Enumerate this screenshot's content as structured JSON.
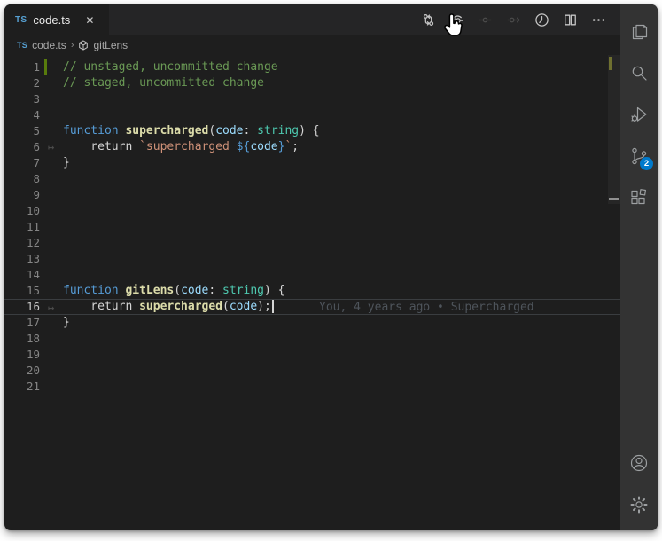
{
  "tab_bar": {
    "tab": {
      "label": "code.ts",
      "file_icon_label": "TS",
      "close_glyph": "✕"
    },
    "actions": [
      {
        "name": "gitlens-compare-button",
        "icon": "gitlens-compare",
        "enabled": true
      },
      {
        "name": "previous-change-button",
        "icon": "prev-change",
        "enabled": true
      },
      {
        "name": "current-change-button",
        "icon": "commit-dot",
        "enabled": false
      },
      {
        "name": "next-change-button",
        "icon": "next-change",
        "enabled": false
      },
      {
        "name": "file-history-button",
        "icon": "history-clock",
        "enabled": true
      },
      {
        "name": "split-editor-button",
        "icon": "split-editor",
        "enabled": true
      },
      {
        "name": "more-actions-button",
        "icon": "ellipsis",
        "enabled": true
      }
    ]
  },
  "breadcrumb": {
    "file_icon_label": "TS",
    "file": "code.ts",
    "separator": "›",
    "symbol": "gitLens"
  },
  "editor": {
    "gutter_arrow_glyph": "↦",
    "blame_text": "You, 4 years ago • Supercharged",
    "lines": [
      {
        "n": 1,
        "gutter": "added",
        "tokens": [
          {
            "t": "// unstaged, uncommitted change",
            "c": "comment"
          }
        ]
      },
      {
        "n": 2,
        "tokens": [
          {
            "t": "// staged, uncommitted change",
            "c": "comment"
          }
        ]
      },
      {
        "n": 3,
        "tokens": []
      },
      {
        "n": 4,
        "tokens": []
      },
      {
        "n": 5,
        "tokens": [
          {
            "t": "function ",
            "c": "kw"
          },
          {
            "t": "supercharged",
            "c": "fn"
          },
          {
            "t": "(",
            "c": "punct"
          },
          {
            "t": "code",
            "c": "var"
          },
          {
            "t": ": ",
            "c": "punct"
          },
          {
            "t": "string",
            "c": "type"
          },
          {
            "t": ") {",
            "c": "punct"
          }
        ]
      },
      {
        "n": 6,
        "gutter": "arrow",
        "tokens": [
          {
            "t": "    return ",
            "c": "plain"
          },
          {
            "t": "`supercharged ",
            "c": "str"
          },
          {
            "t": "${",
            "c": "kw"
          },
          {
            "t": "code",
            "c": "var"
          },
          {
            "t": "}",
            "c": "kw"
          },
          {
            "t": "`",
            "c": "str"
          },
          {
            "t": ";",
            "c": "punct"
          }
        ]
      },
      {
        "n": 7,
        "tokens": [
          {
            "t": "}",
            "c": "punct"
          }
        ]
      },
      {
        "n": 8,
        "tokens": []
      },
      {
        "n": 9,
        "tokens": []
      },
      {
        "n": 10,
        "tokens": []
      },
      {
        "n": 11,
        "tokens": []
      },
      {
        "n": 12,
        "tokens": []
      },
      {
        "n": 13,
        "tokens": []
      },
      {
        "n": 14,
        "tokens": []
      },
      {
        "n": 15,
        "tokens": [
          {
            "t": "function ",
            "c": "kw"
          },
          {
            "t": "gitLens",
            "c": "fn"
          },
          {
            "t": "(",
            "c": "punct"
          },
          {
            "t": "code",
            "c": "var"
          },
          {
            "t": ": ",
            "c": "punct"
          },
          {
            "t": "string",
            "c": "type"
          },
          {
            "t": ") {",
            "c": "punct"
          }
        ]
      },
      {
        "n": 16,
        "gutter": "arrow",
        "current": true,
        "cursor": true,
        "blame": "You, 4 years ago • Supercharged",
        "tokens": [
          {
            "t": "    return ",
            "c": "plain"
          },
          {
            "t": "supercharged",
            "c": "fn"
          },
          {
            "t": "(",
            "c": "punct"
          },
          {
            "t": "code",
            "c": "var"
          },
          {
            "t": ");",
            "c": "punct"
          }
        ]
      },
      {
        "n": 17,
        "tokens": [
          {
            "t": "}",
            "c": "punct"
          }
        ]
      },
      {
        "n": 18,
        "tokens": []
      },
      {
        "n": 19,
        "tokens": []
      },
      {
        "n": 20,
        "tokens": []
      },
      {
        "n": 21,
        "tokens": []
      }
    ]
  },
  "activity_bar": {
    "top": [
      {
        "name": "explorer",
        "icon": "files"
      },
      {
        "name": "search",
        "icon": "search"
      },
      {
        "name": "run-and-debug",
        "icon": "debug"
      },
      {
        "name": "source-control",
        "icon": "source-control",
        "badge": "2"
      },
      {
        "name": "extensions",
        "icon": "extensions"
      }
    ],
    "bottom": [
      {
        "name": "accounts",
        "icon": "account"
      },
      {
        "name": "settings",
        "icon": "gear"
      }
    ]
  },
  "colors": {
    "editor_bg": "#1e1e1e",
    "tab_bar_bg": "#252526",
    "activity_bar_bg": "#333333",
    "badge_accent": "#007acc",
    "added_gutter": "#587c0c",
    "blame_fg": "#4e545b",
    "ts_icon_blue": "#56a0d2"
  }
}
